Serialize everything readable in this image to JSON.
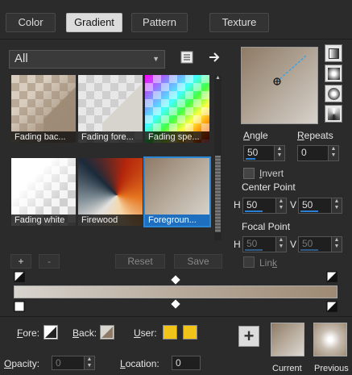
{
  "tabs": [
    "Color",
    "Gradient",
    "Pattern",
    "Texture"
  ],
  "active_tab": "Gradient",
  "category": {
    "value": "All"
  },
  "gradients": [
    {
      "label": "Fading bac..."
    },
    {
      "label": "Fading fore..."
    },
    {
      "label": "Fading spe..."
    },
    {
      "label": "Fading white"
    },
    {
      "label": "Firewood"
    },
    {
      "label": "Foregroun..."
    }
  ],
  "gradient_buttons": {
    "add": "+",
    "remove": "-",
    "reset": "Reset",
    "save": "Save"
  },
  "angle": {
    "label": "Angle",
    "underline": "A",
    "rest": "ngle",
    "value": "50"
  },
  "repeats": {
    "label": "Repeats",
    "underline": "R",
    "rest": "epeats",
    "value": "0"
  },
  "invert": {
    "label": "Invert",
    "underline": "I",
    "rest": "nvert",
    "checked": false
  },
  "center_point": {
    "label": "Center Point",
    "h_label": "H",
    "v_label": "V",
    "h": "50",
    "v": "50"
  },
  "focal_point": {
    "label": "Focal Point",
    "h_label": "H",
    "v_label": "V",
    "h": "50",
    "v": "50"
  },
  "link": {
    "label": "Link",
    "underline": "k",
    "pre": "Lin",
    "checked": false
  },
  "bottom": {
    "fore": {
      "label": "Fore:",
      "underline": "F",
      "rest": "ore:"
    },
    "back": {
      "label": "Back:",
      "underline": "B",
      "rest": "ack:"
    },
    "user": {
      "label": "User:",
      "underline": "U",
      "rest": "ser:"
    },
    "opacity": {
      "label": "Opacity:",
      "underline": "O",
      "rest": "pacity:",
      "value": "0"
    },
    "location": {
      "label": "Location:",
      "underline": "L",
      "rest": "ocation:",
      "value": "0"
    },
    "add": "+",
    "current": "Current",
    "previous": "Previous"
  },
  "colors": {
    "accent": "#2a87d6",
    "fore": "#9e8a74",
    "back": "#d9d6d0",
    "user": "#f0c419"
  }
}
